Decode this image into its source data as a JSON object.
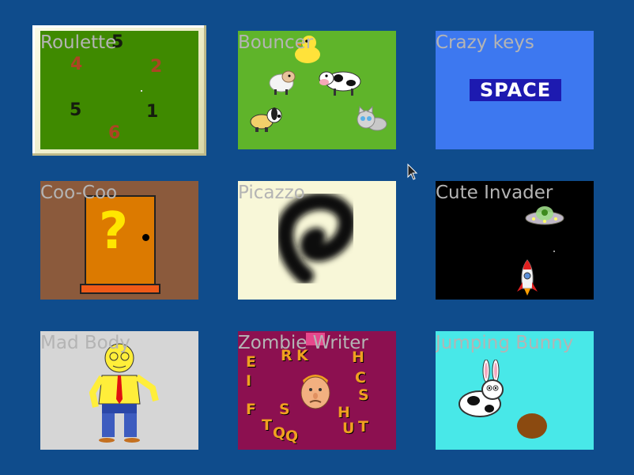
{
  "tiles": [
    {
      "title": "Roulette",
      "selected": true,
      "bg": "#3f8a00"
    },
    {
      "title": "Bouncer",
      "bg": "#5fb42a"
    },
    {
      "title": "Crazy keys",
      "bg": "#3d78f0"
    },
    {
      "title": "Coo-Coo",
      "bg": "#8b5a3c"
    },
    {
      "title": "Picazzo",
      "bg": "#f8f7d8"
    },
    {
      "title": "Cute Invader",
      "bg": "#000000"
    },
    {
      "title": "Mad Body",
      "bg": "#d6d6d6"
    },
    {
      "title": "Zombie Writer",
      "bg": "#8c1050"
    },
    {
      "title": "Jumping Bunny",
      "bg": "#48e8e8"
    }
  ],
  "roulette_numbers": [
    "5",
    "4",
    "2",
    "5",
    "1",
    "6"
  ],
  "crazy_keys_label": "SPACE",
  "coo_coo_symbol": "?",
  "zombie_letters": [
    "R",
    "K",
    "H",
    "I",
    "C",
    "F",
    "S",
    "H",
    "T",
    "Q",
    "Q",
    "S",
    "E",
    "T",
    "U"
  ],
  "icons": {
    "bouncer": [
      "duck-icon",
      "sheep-icon",
      "cow-icon",
      "dog-icon",
      "cat-icon"
    ],
    "invader": [
      "ufo-icon",
      "rocket-icon"
    ],
    "bunny": [
      "bunny-icon",
      "ball-icon"
    ]
  }
}
